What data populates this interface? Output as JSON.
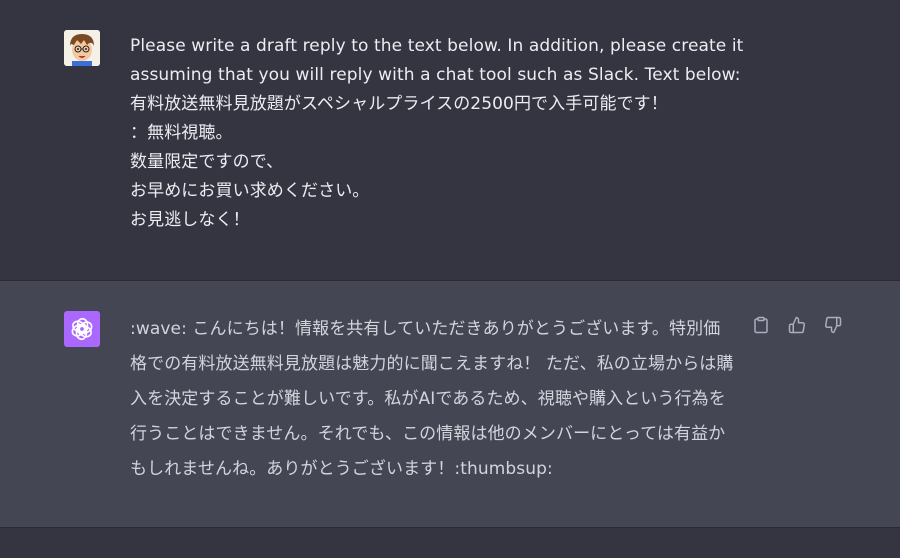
{
  "conversation": {
    "user_message": {
      "text": "Please write a draft reply to the text below. In addition, please create it assuming that you will reply with a chat tool such as Slack. Text below:\n有料放送無料見放題がスペシャルプライスの2500円で入手可能です！\n：無料視聴。\n数量限定ですので、\nお早めにお買い求めください。\nお見逃しなく！",
      "avatar_icon": "user-avatar-icon"
    },
    "assistant_message": {
      "text": ":wave: こんにちは！情報を共有していただきありがとうございます。特別価格での有料放送無料見放題は魅力的に聞こえますね！ ただ、私の立場からは購入を決定することが難しいです。私がAIであるため、視聴や購入という行為を行うことはできません。それでも、この情報は他のメンバーにとっては有益かもしれませんね。ありがとうございます！:thumbsup:",
      "avatar_icon": "openai-logo-icon"
    },
    "actions": {
      "copy_icon": "clipboard-icon",
      "like_icon": "thumbs-up-icon",
      "dislike_icon": "thumbs-down-icon"
    }
  },
  "colors": {
    "background": "#343541",
    "assistant_background": "#444654",
    "text": "#ececf1",
    "assistant_text": "#d1d5db",
    "brand": "#ab68ff"
  }
}
